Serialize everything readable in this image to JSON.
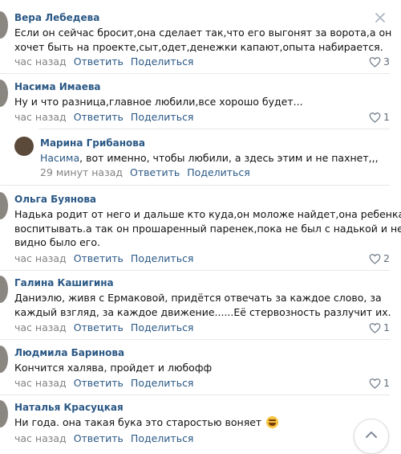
{
  "comments": [
    {
      "author": "Вера Лебедева",
      "lines": [
        "Если он сейчас бросит,она сделает так,что его выгонят за ворота,а он",
        "хочет быть на проекте,сыт,одет,денежки капают,опыта набирается."
      ],
      "time": "час назад",
      "reply": "Ответить",
      "share": "Поделиться",
      "likes": "3"
    },
    {
      "author": "Насима Имаева",
      "lines": [
        "Ну и что разница,главное любили,все хорошо будет..."
      ],
      "time": "час назад",
      "reply": "Ответить",
      "share": "Поделиться",
      "likes": "1"
    },
    {
      "author": "Марина Грибанова",
      "mention": "Насима",
      "lines": [
        ", вот именно, чтобы любили, а здесь этим и не пахнет,,,"
      ],
      "time": "29 минут назад",
      "reply": "Ответить",
      "share": "Поделиться",
      "likes": ""
    },
    {
      "author": "Ольга Буянова",
      "lines": [
        "Надька родит от него и дальше кто куда,он моложе найдет,она ребенка",
        "воспитывать.а так он прошаренный паренек,пока не был с надькой и не",
        "видно было его."
      ],
      "time": "час назад",
      "reply": "Ответить",
      "share": "Поделиться",
      "likes": "2"
    },
    {
      "author": "Галина Кашигина",
      "lines": [
        "Даниэлю, живя с Ермаковой, придётся отвечать за каждое слово, за",
        "каждый взгляд, за каждое движение......Её стервозность разлучит их."
      ],
      "time": "час назад",
      "reply": "Ответить",
      "share": "Поделиться",
      "likes": "1"
    },
    {
      "author": "Людмила Баринова",
      "lines": [
        "Кончится халява, пройдет и любофф"
      ],
      "time": "час назад",
      "reply": "Ответить",
      "share": "Поделиться",
      "likes": "1"
    },
    {
      "author": "Наталья Красуцкая",
      "lines": [
        "Ни года. она такая бука это старостью воняет"
      ],
      "time": "час назад",
      "reply": "Ответить",
      "share": "Поделиться",
      "likes": ""
    }
  ],
  "icons": {
    "close": "close-icon",
    "like": "heart-icon",
    "scroll": "chevron-up-icon",
    "emoji": "rofl-emoji-icon"
  },
  "colors": {
    "link": "#2a5885",
    "meta": "#828282",
    "text": "#111111"
  }
}
